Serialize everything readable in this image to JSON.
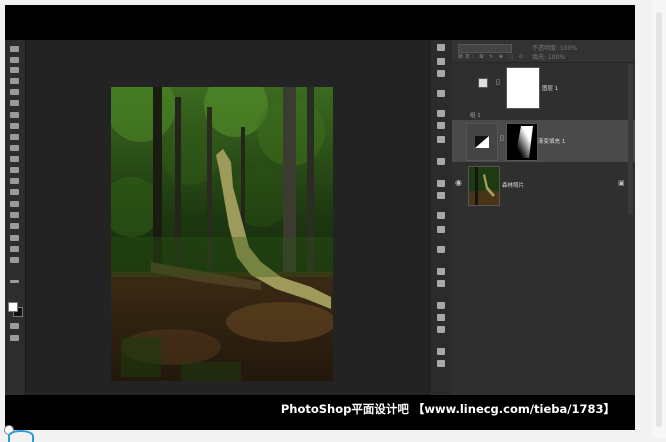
{
  "app": {
    "name": "Photoshop"
  },
  "canvas": {
    "subject": "forest-photo"
  },
  "layers_panel": {
    "top_mode": "正常",
    "top_opacity": "不透明度: 100%",
    "top_fill": "填充: 100%",
    "top_lock_row": "锁定: ⊠ ✎ ✥ ⬚ ⊙",
    "group_label": "组 1",
    "layers": [
      {
        "name": "图层 1",
        "visible": false
      },
      {
        "name": "渐变填充 1",
        "visible": false,
        "selected": true
      },
      {
        "name": "森林照片",
        "visible": true,
        "locked": true
      }
    ]
  },
  "watermark": "PhotoShop平面设计吧 【www.linecg.com/tieba/1783】",
  "colors": {
    "workspace": "#232323",
    "panel": "#2f2f2f",
    "selected_layer": "#4a4a4a"
  }
}
